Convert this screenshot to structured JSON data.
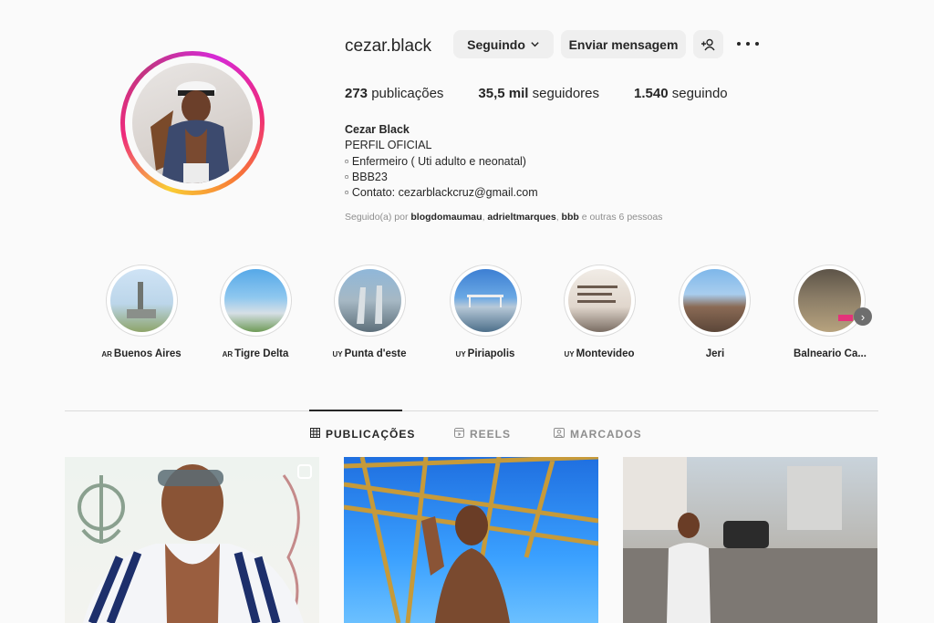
{
  "profile": {
    "username": "cezar.black",
    "following_button": "Seguindo",
    "message_button": "Enviar mensagem",
    "stats": {
      "posts_count": "273",
      "posts_label": "publicações",
      "followers_count": "35,5 mil",
      "followers_label": "seguidores",
      "following_count": "1.540",
      "following_label": "seguindo"
    },
    "bio": {
      "name": "Cezar Black",
      "line1": "PERFIL OFICIAL",
      "line2": "▫ Enfermeiro ( Uti adulto e neonatal)",
      "line3": "▫ BBB23",
      "line4": "▫ Contato: cezarblackcruz@gmail.com"
    },
    "followed_by": {
      "prefix": "Seguido(a) por",
      "user1": "blogdomaumau",
      "user2": "adrieltmarques",
      "user3": "bbb",
      "suffix": "e outras 6 pessoas"
    }
  },
  "highlights": [
    {
      "flag": "AR",
      "label": "Buenos Aires"
    },
    {
      "flag": "AR",
      "label": "Tigre Delta"
    },
    {
      "flag": "UY",
      "label": "Punta d'este"
    },
    {
      "flag": "UY",
      "label": "Piriapolis"
    },
    {
      "flag": "UY",
      "label": "Montevideo"
    },
    {
      "flag": "",
      "label": "Jeri"
    },
    {
      "flag": "",
      "label": "Balneario Ca..."
    }
  ],
  "tabs": {
    "posts": "PUBLICAÇÕES",
    "reels": "REELS",
    "tagged": "MARCADOS"
  },
  "icons": {
    "chevron": "chevron-down-icon",
    "suggest": "add-person-icon",
    "more": "more-options-icon",
    "grid": "grid-icon",
    "reels": "reels-icon",
    "tagged": "tagged-icon",
    "next": "chevron-right-icon"
  }
}
